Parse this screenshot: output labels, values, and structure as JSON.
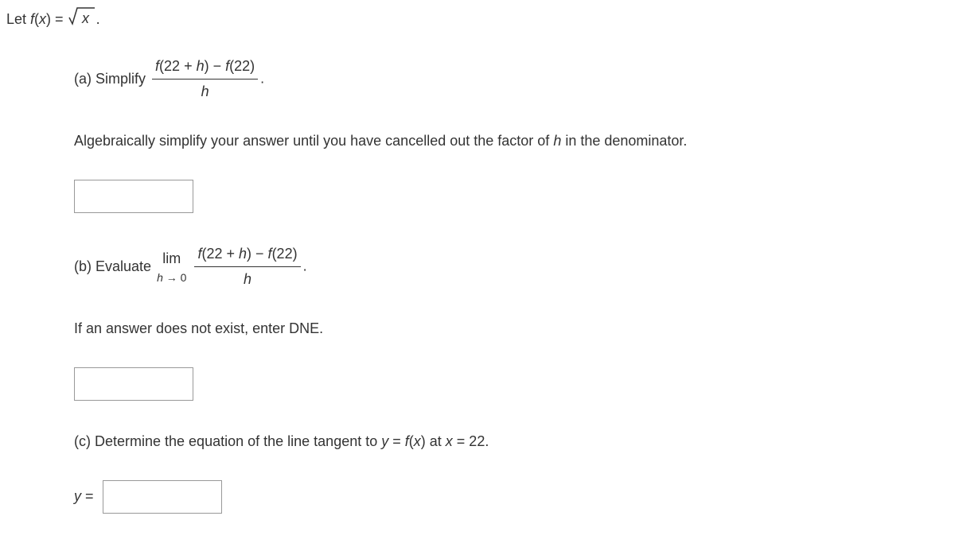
{
  "intro": {
    "let": "Let ",
    "func": "f",
    "of_x": "(x) = ",
    "sqrt_x": "x",
    "period": "."
  },
  "partA": {
    "label": "(a) Simplify ",
    "frac_num_f1": "f",
    "frac_num_arg1": "(22 + ",
    "frac_num_h1": "h",
    "frac_num_close1": ") − ",
    "frac_num_f2": "f",
    "frac_num_arg2": "(22)",
    "frac_den": "h",
    "period": ".",
    "instruction_pre": "Algebraically simplify your answer until you have cancelled out the factor of ",
    "instruction_h": "h",
    "instruction_post": " in the denominator."
  },
  "partB": {
    "label": "(b) Evaluate ",
    "lim_top": "lim",
    "lim_bottom_h": "h",
    "lim_bottom_arrow": " → 0",
    "frac_num_f1": "f",
    "frac_num_arg1": "(22 + ",
    "frac_num_h1": "h",
    "frac_num_close1": ") − ",
    "frac_num_f2": "f",
    "frac_num_arg2": "(22)",
    "frac_den": "h",
    "period": ".",
    "instruction": "If an answer does not exist, enter DNE."
  },
  "partC": {
    "label_pre": "(c) Determine the equation of the line tangent to ",
    "y": "y",
    "eq1": " = ",
    "f": "f",
    "of_x": "(x)",
    "at": " at ",
    "x": "x",
    "eq2": " = 22.",
    "answer_label_y": "y",
    "answer_label_eq": " ="
  }
}
